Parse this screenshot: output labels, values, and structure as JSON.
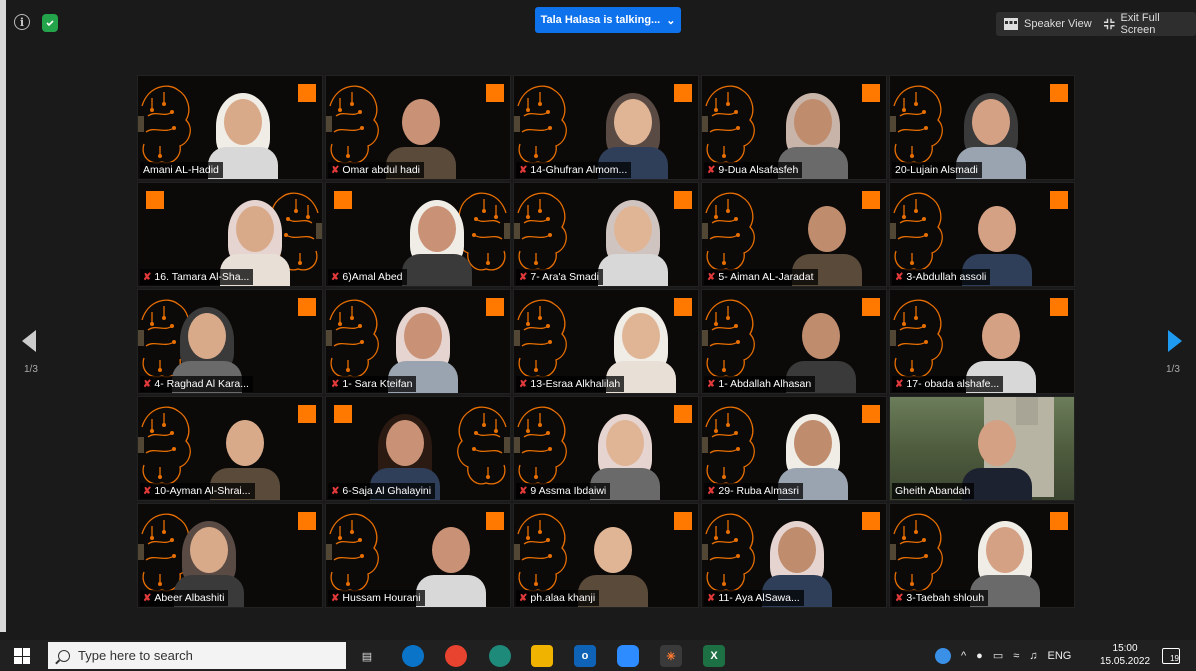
{
  "topbar": {
    "talking_label": "Tala Halasa is talking...",
    "speaker_view_label": "Speaker View",
    "exit_fullscreen_label": "Exit Full Screen",
    "talk_pill_color": "#0e72ed"
  },
  "pagination": {
    "left": "1/3",
    "right": "1/3"
  },
  "participants": [
    {
      "name": "Amani AL-Hadid",
      "muted": false,
      "kind": "hijab"
    },
    {
      "name": "Omar abdul hadi",
      "muted": true,
      "kind": "man"
    },
    {
      "name": "14-Ghufran Almom...",
      "muted": true,
      "kind": "hijab"
    },
    {
      "name": "9-Dua Alsafasfeh",
      "muted": true,
      "kind": "hijab"
    },
    {
      "name": "20-Lujain Alsmadi",
      "muted": false,
      "kind": "hijab"
    },
    {
      "name": "16. Tamara Al-Sha...",
      "muted": true,
      "kind": "hijab"
    },
    {
      "name": "6)Amal Abed",
      "muted": true,
      "kind": "hijab"
    },
    {
      "name": "7- Ara'a Smadi",
      "muted": true,
      "kind": "hijab"
    },
    {
      "name": "5- Aiman AL-Jaradat",
      "muted": true,
      "kind": "man"
    },
    {
      "name": "3-Abdullah assoli",
      "muted": true,
      "kind": "man"
    },
    {
      "name": "4- Raghad Al Kara...",
      "muted": true,
      "kind": "hijab"
    },
    {
      "name": "1- Sara Kteifan",
      "muted": true,
      "kind": "hijab"
    },
    {
      "name": "13-Esraa Alkhalilah",
      "muted": true,
      "kind": "hijab"
    },
    {
      "name": "1- Abdallah Alhasan",
      "muted": true,
      "kind": "man"
    },
    {
      "name": "17- obada alshafe...",
      "muted": true,
      "kind": "man"
    },
    {
      "name": "10-Ayman Al-Shrai...",
      "muted": true,
      "kind": "man"
    },
    {
      "name": "6-Saja Al Ghalayini",
      "muted": true,
      "kind": "woman"
    },
    {
      "name": "9 Assma Ibdaiwi",
      "muted": true,
      "kind": "hijab"
    },
    {
      "name": "29- Ruba Almasri",
      "muted": true,
      "kind": "hijab"
    },
    {
      "name": "Gheith Abandah",
      "muted": false,
      "kind": "photo"
    },
    {
      "name": "Abeer Albashiti",
      "muted": true,
      "kind": "hijab"
    },
    {
      "name": "Hussam Hourani",
      "muted": true,
      "kind": "man"
    },
    {
      "name": "ph.alaa khanji",
      "muted": true,
      "kind": "man"
    },
    {
      "name": "11- Aya AlSawa...",
      "muted": true,
      "kind": "hijab"
    },
    {
      "name": "3-Taebah shlouh",
      "muted": true,
      "kind": "hijab"
    }
  ],
  "taskbar": {
    "search_placeholder": "Type here to search",
    "language": "ENG",
    "time": "15:00",
    "date": "15.05.2022",
    "notification_count": "19"
  },
  "colors": {
    "brand_orange": "#ff7900",
    "mute_red": "#e23a3a",
    "accent_blue": "#1e9bf0"
  }
}
